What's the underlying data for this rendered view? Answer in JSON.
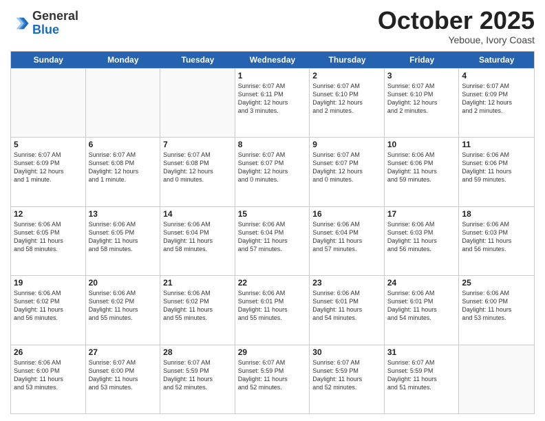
{
  "header": {
    "logo_general": "General",
    "logo_blue": "Blue",
    "month": "October 2025",
    "location": "Yeboue, Ivory Coast"
  },
  "day_headers": [
    "Sunday",
    "Monday",
    "Tuesday",
    "Wednesday",
    "Thursday",
    "Friday",
    "Saturday"
  ],
  "weeks": [
    [
      {
        "date": "",
        "info": ""
      },
      {
        "date": "",
        "info": ""
      },
      {
        "date": "",
        "info": ""
      },
      {
        "date": "1",
        "info": "Sunrise: 6:07 AM\nSunset: 6:11 PM\nDaylight: 12 hours\nand 3 minutes."
      },
      {
        "date": "2",
        "info": "Sunrise: 6:07 AM\nSunset: 6:10 PM\nDaylight: 12 hours\nand 2 minutes."
      },
      {
        "date": "3",
        "info": "Sunrise: 6:07 AM\nSunset: 6:10 PM\nDaylight: 12 hours\nand 2 minutes."
      },
      {
        "date": "4",
        "info": "Sunrise: 6:07 AM\nSunset: 6:09 PM\nDaylight: 12 hours\nand 2 minutes."
      }
    ],
    [
      {
        "date": "5",
        "info": "Sunrise: 6:07 AM\nSunset: 6:09 PM\nDaylight: 12 hours\nand 1 minute."
      },
      {
        "date": "6",
        "info": "Sunrise: 6:07 AM\nSunset: 6:08 PM\nDaylight: 12 hours\nand 1 minute."
      },
      {
        "date": "7",
        "info": "Sunrise: 6:07 AM\nSunset: 6:08 PM\nDaylight: 12 hours\nand 0 minutes."
      },
      {
        "date": "8",
        "info": "Sunrise: 6:07 AM\nSunset: 6:07 PM\nDaylight: 12 hours\nand 0 minutes."
      },
      {
        "date": "9",
        "info": "Sunrise: 6:07 AM\nSunset: 6:07 PM\nDaylight: 12 hours\nand 0 minutes."
      },
      {
        "date": "10",
        "info": "Sunrise: 6:06 AM\nSunset: 6:06 PM\nDaylight: 11 hours\nand 59 minutes."
      },
      {
        "date": "11",
        "info": "Sunrise: 6:06 AM\nSunset: 6:06 PM\nDaylight: 11 hours\nand 59 minutes."
      }
    ],
    [
      {
        "date": "12",
        "info": "Sunrise: 6:06 AM\nSunset: 6:05 PM\nDaylight: 11 hours\nand 58 minutes."
      },
      {
        "date": "13",
        "info": "Sunrise: 6:06 AM\nSunset: 6:05 PM\nDaylight: 11 hours\nand 58 minutes."
      },
      {
        "date": "14",
        "info": "Sunrise: 6:06 AM\nSunset: 6:04 PM\nDaylight: 11 hours\nand 58 minutes."
      },
      {
        "date": "15",
        "info": "Sunrise: 6:06 AM\nSunset: 6:04 PM\nDaylight: 11 hours\nand 57 minutes."
      },
      {
        "date": "16",
        "info": "Sunrise: 6:06 AM\nSunset: 6:04 PM\nDaylight: 11 hours\nand 57 minutes."
      },
      {
        "date": "17",
        "info": "Sunrise: 6:06 AM\nSunset: 6:03 PM\nDaylight: 11 hours\nand 56 minutes."
      },
      {
        "date": "18",
        "info": "Sunrise: 6:06 AM\nSunset: 6:03 PM\nDaylight: 11 hours\nand 56 minutes."
      }
    ],
    [
      {
        "date": "19",
        "info": "Sunrise: 6:06 AM\nSunset: 6:02 PM\nDaylight: 11 hours\nand 56 minutes."
      },
      {
        "date": "20",
        "info": "Sunrise: 6:06 AM\nSunset: 6:02 PM\nDaylight: 11 hours\nand 55 minutes."
      },
      {
        "date": "21",
        "info": "Sunrise: 6:06 AM\nSunset: 6:02 PM\nDaylight: 11 hours\nand 55 minutes."
      },
      {
        "date": "22",
        "info": "Sunrise: 6:06 AM\nSunset: 6:01 PM\nDaylight: 11 hours\nand 55 minutes."
      },
      {
        "date": "23",
        "info": "Sunrise: 6:06 AM\nSunset: 6:01 PM\nDaylight: 11 hours\nand 54 minutes."
      },
      {
        "date": "24",
        "info": "Sunrise: 6:06 AM\nSunset: 6:01 PM\nDaylight: 11 hours\nand 54 minutes."
      },
      {
        "date": "25",
        "info": "Sunrise: 6:06 AM\nSunset: 6:00 PM\nDaylight: 11 hours\nand 53 minutes."
      }
    ],
    [
      {
        "date": "26",
        "info": "Sunrise: 6:06 AM\nSunset: 6:00 PM\nDaylight: 11 hours\nand 53 minutes."
      },
      {
        "date": "27",
        "info": "Sunrise: 6:07 AM\nSunset: 6:00 PM\nDaylight: 11 hours\nand 53 minutes."
      },
      {
        "date": "28",
        "info": "Sunrise: 6:07 AM\nSunset: 5:59 PM\nDaylight: 11 hours\nand 52 minutes."
      },
      {
        "date": "29",
        "info": "Sunrise: 6:07 AM\nSunset: 5:59 PM\nDaylight: 11 hours\nand 52 minutes."
      },
      {
        "date": "30",
        "info": "Sunrise: 6:07 AM\nSunset: 5:59 PM\nDaylight: 11 hours\nand 52 minutes."
      },
      {
        "date": "31",
        "info": "Sunrise: 6:07 AM\nSunset: 5:59 PM\nDaylight: 11 hours\nand 51 minutes."
      },
      {
        "date": "",
        "info": ""
      }
    ]
  ]
}
